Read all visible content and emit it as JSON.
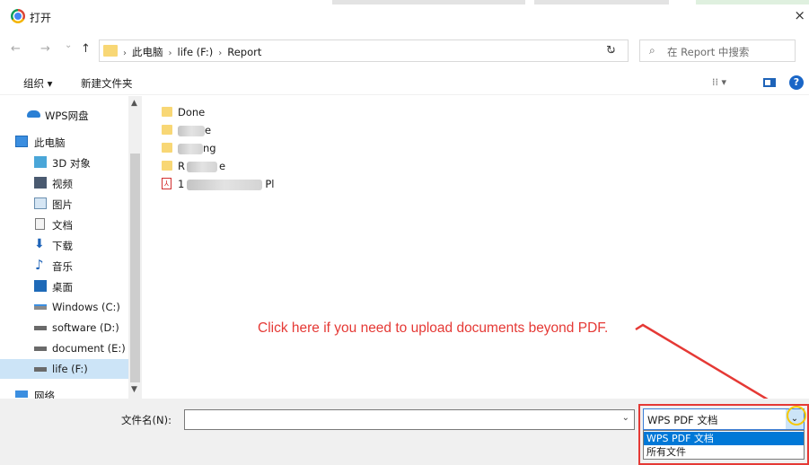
{
  "window": {
    "title": "打开",
    "close_glyph": "×"
  },
  "icons": {
    "back": "←",
    "forward": "→",
    "recent": "⌄",
    "up": "↑",
    "dropdown": "⌄",
    "refresh": "↻",
    "search": "⌕",
    "view": "⁞⁞ ▾",
    "help": "?"
  },
  "address": {
    "crumbs": [
      "此电脑",
      "life (F:)",
      "Report"
    ],
    "separator": "›"
  },
  "search": {
    "placeholder": "在 Report 中搜索"
  },
  "toolbar": {
    "organize": "组织 ▾",
    "new_folder": "新建文件夹"
  },
  "nav": {
    "items": [
      {
        "label": "WPS网盘",
        "icon": "cloud-icon"
      },
      {
        "label": "此电脑",
        "icon": "computer-icon"
      },
      {
        "label": "3D 对象",
        "icon": "3d-objects-icon"
      },
      {
        "label": "视频",
        "icon": "video-icon"
      },
      {
        "label": "图片",
        "icon": "pictures-icon"
      },
      {
        "label": "文档",
        "icon": "documents-icon"
      },
      {
        "label": "下载",
        "icon": "download-icon"
      },
      {
        "label": "音乐",
        "icon": "music-icon"
      },
      {
        "label": "桌面",
        "icon": "desktop-icon"
      },
      {
        "label": "Windows (C:)",
        "icon": "drive-icon"
      },
      {
        "label": "software (D:)",
        "icon": "drive-icon"
      },
      {
        "label": "document (E:)",
        "icon": "drive-icon"
      },
      {
        "label": "life (F:)",
        "icon": "drive-icon",
        "selected": true
      },
      {
        "label": "网络",
        "icon": "network-icon"
      }
    ]
  },
  "files": [
    {
      "type": "folder",
      "prefix": "Done",
      "suffix": ""
    },
    {
      "type": "folder",
      "prefix": "",
      "suffix": "e"
    },
    {
      "type": "folder",
      "prefix": "",
      "suffix": "ng"
    },
    {
      "type": "folder",
      "prefix": "R",
      "suffix": "e"
    },
    {
      "type": "pdf",
      "prefix": "1",
      "suffix": "Pl"
    }
  ],
  "annotation": "Click here if you need to upload documents beyond PDF.",
  "bottom": {
    "filename_label": "文件名(N):",
    "filename_value": "",
    "filetype_selected": "WPS PDF 文档",
    "filetype_options": [
      "WPS PDF 文档",
      "所有文件"
    ]
  },
  "colors": {
    "annotation_red": "#e53935",
    "selection_blue": "#0078d7",
    "folder_yellow": "#f8d775"
  }
}
